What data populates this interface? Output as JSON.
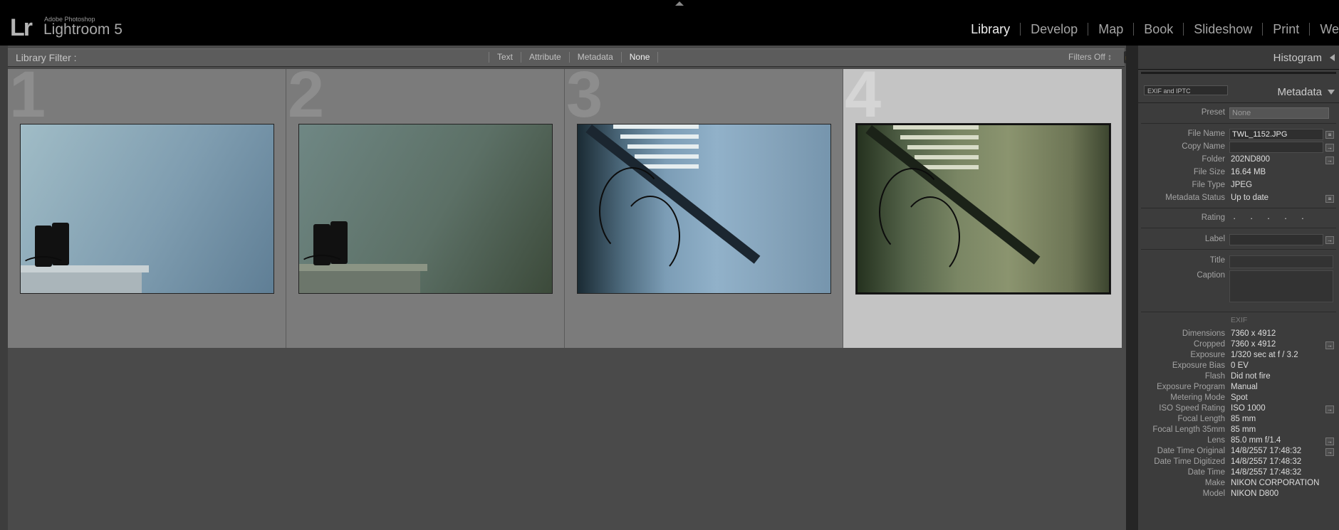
{
  "app": {
    "vendor": "Adobe Photoshop",
    "name": "Lightroom 5",
    "logo": "Lr"
  },
  "modules": [
    "Library",
    "Develop",
    "Map",
    "Book",
    "Slideshow",
    "Print",
    "We"
  ],
  "active_module": "Library",
  "filter_bar": {
    "title": "Library Filter :",
    "options": [
      "Text",
      "Attribute",
      "Metadata",
      "None"
    ],
    "active_option": "None",
    "filters_state": "Filters Off ↕"
  },
  "grid": {
    "cells": [
      {
        "number": "1",
        "selected": false
      },
      {
        "number": "2",
        "selected": false
      },
      {
        "number": "3",
        "selected": false
      },
      {
        "number": "4",
        "selected": true
      }
    ]
  },
  "panel": {
    "histogram_title": "Histogram",
    "metadata_title": "Metadata",
    "metadata_set": "EXIF and IPTC",
    "preset_label": "Preset",
    "preset_value": "None",
    "file_name_label": "File Name",
    "file_name": "TWL_1152.JPG",
    "copy_name_label": "Copy Name",
    "copy_name": "",
    "folder_label": "Folder",
    "folder": "202ND800",
    "file_size_label": "File Size",
    "file_size": "16.64 MB",
    "file_type_label": "File Type",
    "file_type": "JPEG",
    "metadata_status_label": "Metadata Status",
    "metadata_status": "Up to date",
    "rating_label": "Rating",
    "rating_dots": "· · · · ·",
    "label_label": "Label",
    "title_label": "Title",
    "caption_label": "Caption",
    "exif_header": "EXIF",
    "exif": [
      {
        "label": "Dimensions",
        "value": "7360 x 4912",
        "btn": false
      },
      {
        "label": "Cropped",
        "value": "7360 x 4912",
        "btn": true
      },
      {
        "label": "Exposure",
        "value": "1/320 sec at f / 3.2",
        "btn": false
      },
      {
        "label": "Exposure Bias",
        "value": "0 EV",
        "btn": false
      },
      {
        "label": "Flash",
        "value": "Did not fire",
        "btn": false
      },
      {
        "label": "Exposure Program",
        "value": "Manual",
        "btn": false
      },
      {
        "label": "Metering Mode",
        "value": "Spot",
        "btn": false
      },
      {
        "label": "ISO Speed Rating",
        "value": "ISO 1000",
        "btn": true
      },
      {
        "label": "Focal Length",
        "value": "85 mm",
        "btn": false
      },
      {
        "label": "Focal Length 35mm",
        "value": "85 mm",
        "btn": false
      },
      {
        "label": "Lens",
        "value": "85.0 mm f/1.4",
        "btn": true
      },
      {
        "label": "Date Time Original",
        "value": "14/8/2557 17:48:32",
        "btn": true
      },
      {
        "label": "Date Time Digitized",
        "value": "14/8/2557 17:48:32",
        "btn": false
      },
      {
        "label": "Date Time",
        "value": "14/8/2557 17:48:32",
        "btn": false
      },
      {
        "label": "Make",
        "value": "NIKON CORPORATION",
        "btn": false
      },
      {
        "label": "Model",
        "value": "NIKON D800",
        "btn": false
      }
    ]
  }
}
